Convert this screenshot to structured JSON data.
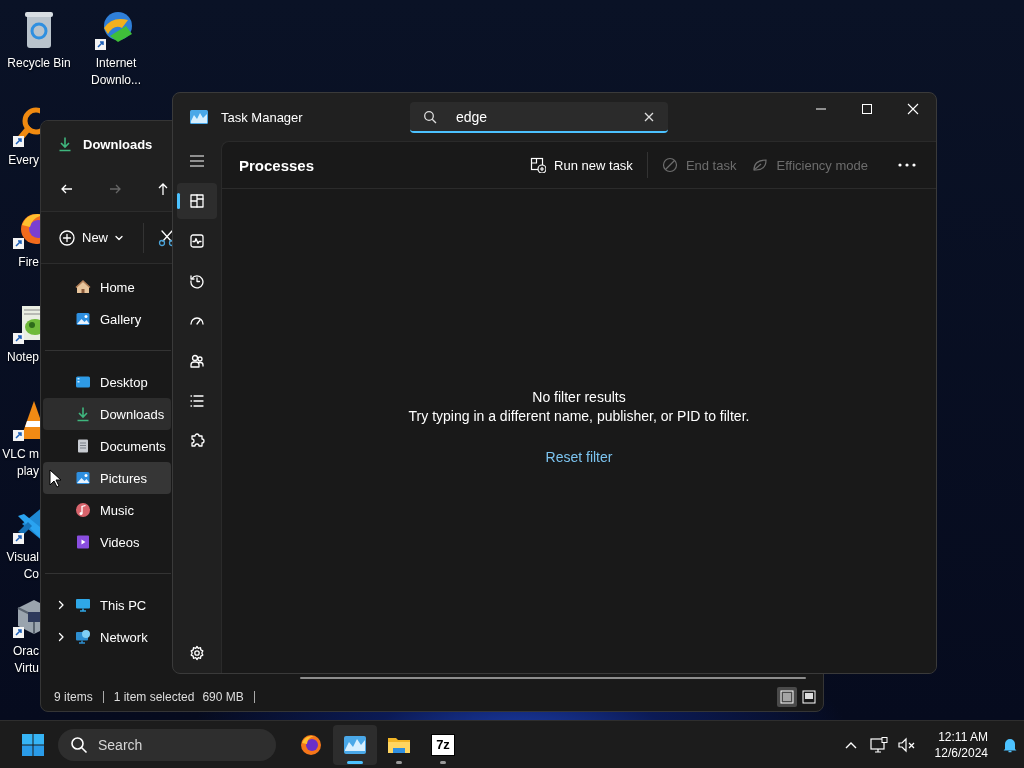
{
  "desktop_icons": [
    {
      "lines": [
        "Recycle Bin"
      ],
      "shortcut": false
    },
    {
      "lines": [
        "Internet",
        "Downlo..."
      ],
      "shortcut": true
    },
    {
      "lines": [
        "Every"
      ],
      "shortcut": true
    },
    {
      "lines": [
        "Fire"
      ],
      "shortcut": true
    },
    {
      "lines": [
        "Notep"
      ],
      "shortcut": true
    },
    {
      "lines": [
        "VLC m",
        "play"
      ],
      "shortcut": true
    },
    {
      "lines": [
        "Visual",
        "Co"
      ],
      "shortcut": true
    },
    {
      "lines": [
        "Orac",
        "Virtu"
      ],
      "shortcut": true
    }
  ],
  "explorer": {
    "title": "Downloads",
    "new_label": "New",
    "nav": [
      {
        "items": [
          {
            "label": "Home",
            "selected": false,
            "hovered": false
          },
          {
            "label": "Gallery",
            "selected": false,
            "hovered": false
          }
        ]
      },
      {
        "items": [
          {
            "label": "Desktop",
            "selected": false,
            "hovered": false
          },
          {
            "label": "Downloads",
            "selected": true,
            "hovered": false
          },
          {
            "label": "Documents",
            "selected": false,
            "hovered": false
          },
          {
            "label": "Pictures",
            "selected": false,
            "hovered": true
          },
          {
            "label": "Music",
            "selected": false,
            "hovered": false
          },
          {
            "label": "Videos",
            "selected": false,
            "hovered": false
          }
        ]
      },
      {
        "items": [
          {
            "label": "This PC",
            "expanded": false
          },
          {
            "label": "Network",
            "expanded": false
          }
        ]
      }
    ],
    "status": {
      "items": "9 items",
      "selection": "1 item selected",
      "size": "690 MB"
    },
    "views": [
      {
        "selected": true
      },
      {
        "selected": false
      }
    ]
  },
  "task_manager": {
    "title": "Task Manager",
    "search": {
      "value": "edge"
    },
    "nav": [
      {
        "selected": true
      },
      {
        "selected": false
      },
      {
        "selected": false
      },
      {
        "selected": false
      },
      {
        "selected": false
      },
      {
        "selected": false
      },
      {
        "selected": false
      }
    ],
    "page_title": "Processes",
    "actions": [
      {
        "label": "Run new task",
        "disabled": false
      },
      {
        "label": "End task",
        "disabled": true
      },
      {
        "label": "Efficiency mode",
        "disabled": true
      }
    ],
    "empty": {
      "title": "No filter results",
      "message": "Try typing in a different name, publisher, or PID to filter.",
      "link": "Reset filter"
    }
  },
  "taskbar": {
    "search": {
      "placeholder": "Search"
    },
    "apps": [
      {
        "running": false,
        "active": false
      },
      {
        "running": true,
        "active": true
      },
      {
        "running": true,
        "active": false
      },
      {
        "glyph": "7z",
        "running": true,
        "active": false
      }
    ],
    "time": "12:11 AM",
    "date": "12/6/2024"
  }
}
